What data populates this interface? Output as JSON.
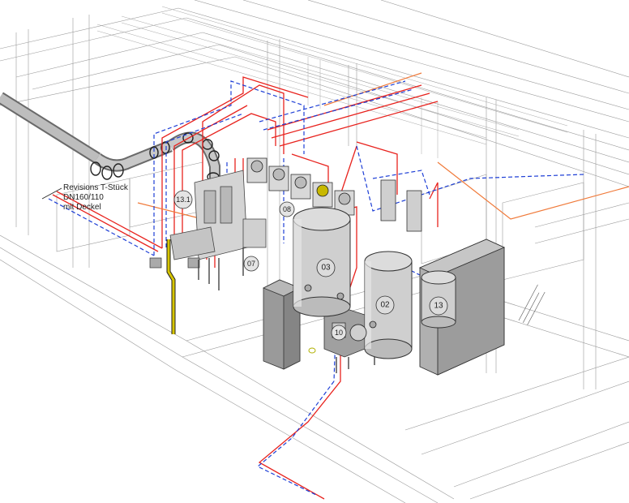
{
  "annotation": {
    "line1": "Revisions T-Stück",
    "line2": "DN160/110",
    "line3": "mit Deckel"
  },
  "callouts": {
    "c03": "03",
    "c02": "02",
    "c13": "13",
    "c13_1": "13.1",
    "c07": "07",
    "c08": "08",
    "c10": "10"
  },
  "colors": {
    "supply": "#e8231e",
    "return": "#1e3fd6",
    "orange": "#f07a3a",
    "structure": "#8a8a8a",
    "equipment": "#bdbdbd",
    "yellow": "#d6c400"
  }
}
